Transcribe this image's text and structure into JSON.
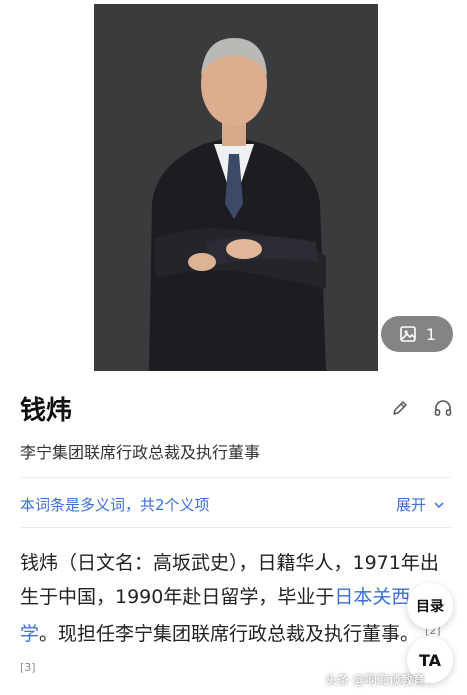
{
  "entry": {
    "name": "钱炜",
    "subtitle": "李宁集团联席行政总裁及执行董事"
  },
  "gallery": {
    "count": "1",
    "icon": "image-gallery-icon"
  },
  "actions": {
    "edit_icon": "pencil-icon",
    "listen_icon": "headphones-icon"
  },
  "polysemy": {
    "note": "本词条是多义词，共2个义项",
    "expand_label": "展开"
  },
  "summary": {
    "text_1": "钱炜（日文名：高坂武史），日籍华人，1971年出生于中国，1990年赴日留学，毕业于",
    "link": "日本关西大学",
    "text_2": "。现担任李宁集团联席行政总裁及执行董事。",
    "refs": "[2][3]"
  },
  "floating": {
    "toc_label": "目录",
    "ta_label": "TA"
  },
  "watermark": "头条 @啊海谈教育",
  "colors": {
    "link": "#3b6fd6",
    "photo_bg": "#3a3b3d"
  }
}
